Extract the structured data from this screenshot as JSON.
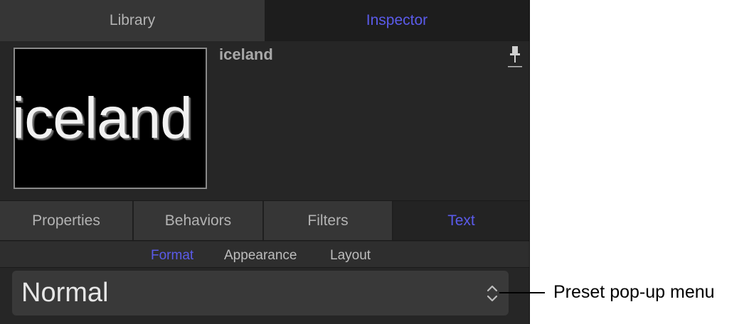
{
  "top_tabs": [
    {
      "label": "Library",
      "active": false
    },
    {
      "label": "Inspector",
      "active": true
    }
  ],
  "preview": {
    "thumbnail_text": "iceland",
    "layer_name": "iceland"
  },
  "sub_tabs": [
    {
      "label": "Properties",
      "active": false
    },
    {
      "label": "Behaviors",
      "active": false
    },
    {
      "label": "Filters",
      "active": false
    },
    {
      "label": "Text",
      "active": true
    }
  ],
  "segments": [
    {
      "label": "Format",
      "active": true
    },
    {
      "label": "Appearance",
      "active": false
    },
    {
      "label": "Layout",
      "active": false
    }
  ],
  "preset": {
    "value": "Normal"
  },
  "callout": {
    "label": "Preset pop-up menu"
  },
  "colors": {
    "accent": "#5b5bea",
    "panel": "#262626",
    "tab_inactive": "#363636"
  },
  "icons": {
    "pin": "pin-icon",
    "stepper": "chevron-up-down-icon"
  }
}
